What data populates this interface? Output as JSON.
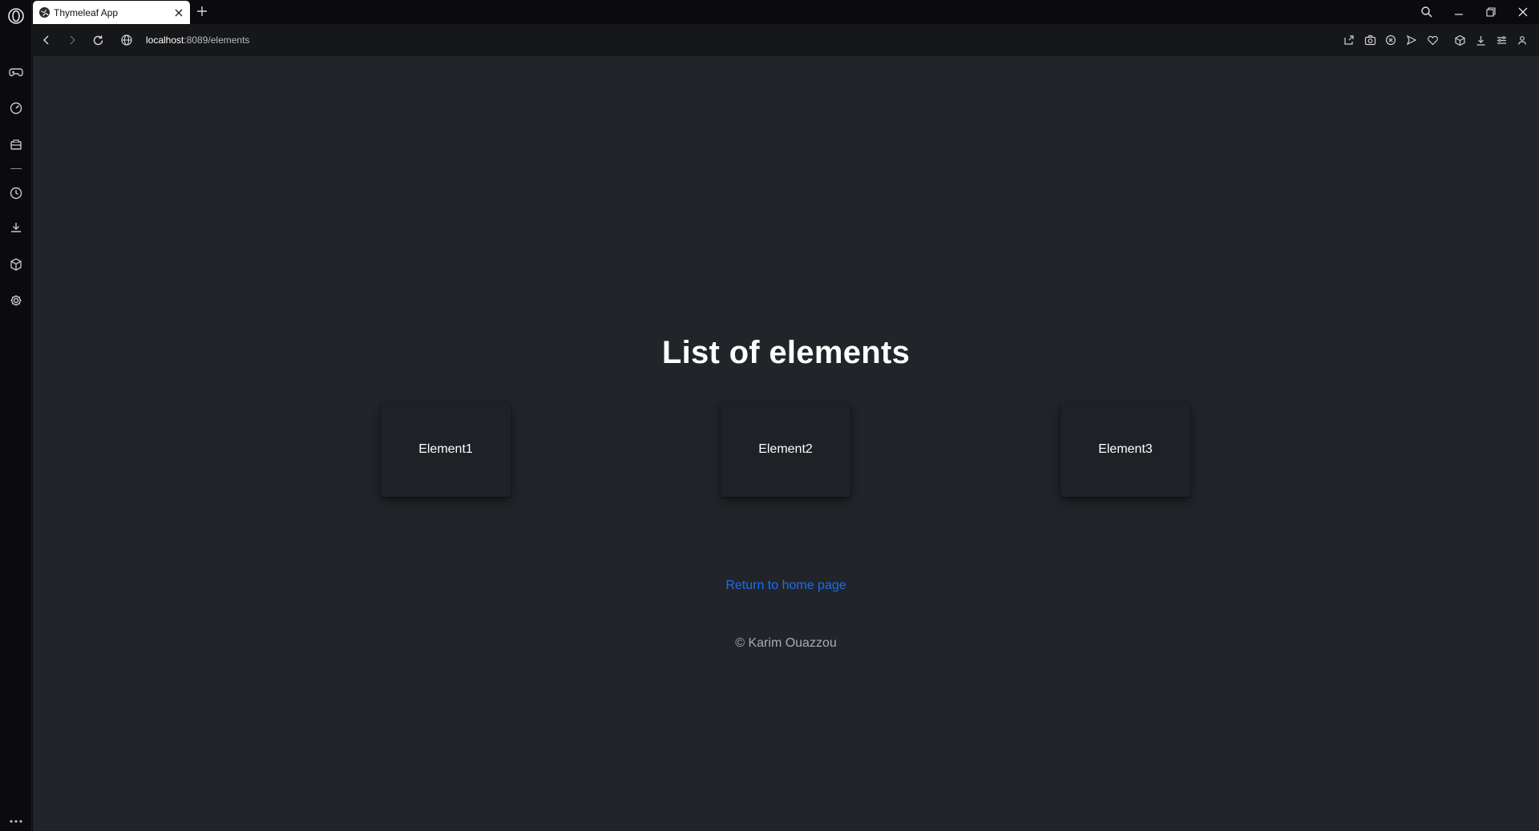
{
  "browser": {
    "tab_title": "Thymeleaf App",
    "url_host": "localhost",
    "url_path": ":8089/elements"
  },
  "page": {
    "heading": "List of elements",
    "elements": [
      {
        "label": "Element1"
      },
      {
        "label": "Element2"
      },
      {
        "label": "Element3"
      }
    ],
    "home_link": "Return to home page",
    "footer": "© Karim Ouazzou"
  },
  "colors": {
    "page_bg": "#212529",
    "card_bg": "#1e2125",
    "link": "#1e6bf0",
    "footer_text": "#a7acb1"
  }
}
